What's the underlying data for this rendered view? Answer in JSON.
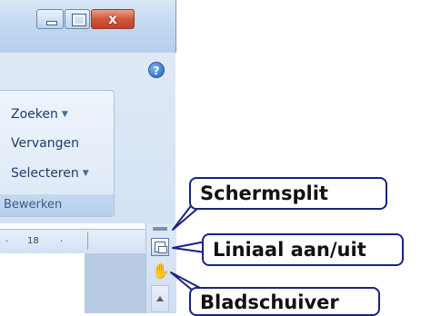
{
  "window": {
    "close_glyph": "x"
  },
  "help": {
    "glyph": "?"
  },
  "editing_group": {
    "commands": [
      {
        "label": "Zoeken",
        "has_dropdown": true
      },
      {
        "label": "Vervangen",
        "has_dropdown": false
      },
      {
        "label": "Selecteren",
        "has_dropdown": true
      }
    ],
    "group_label": "Bewerken"
  },
  "ruler": {
    "tick_left": "·",
    "value": "18",
    "tick_right": "·"
  },
  "scrollbar": {
    "hand_glyph": "✋"
  },
  "callouts": {
    "split": "Schermsplit",
    "ruler_toggle": "Liniaal aan/uit",
    "pan": "Bladschuiver"
  },
  "colors": {
    "callout_border": "#1a237e",
    "ribbon_bg": "#d3e2f4",
    "close_button": "#d0583c"
  }
}
